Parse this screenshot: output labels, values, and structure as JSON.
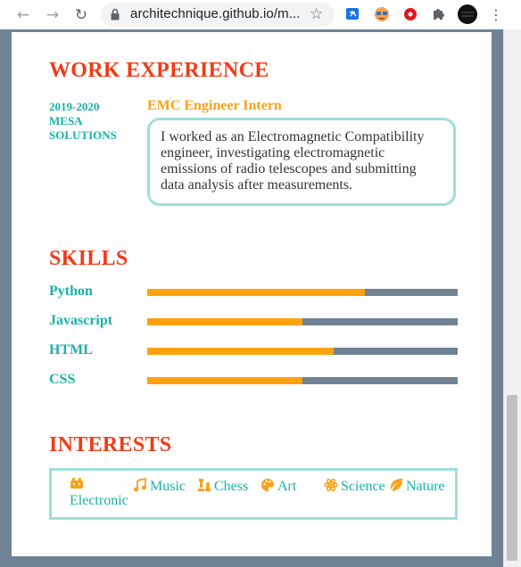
{
  "browser": {
    "url": "architechnique.github.io/m..."
  },
  "work": {
    "heading": "WORK EXPERIENCE",
    "jobs": [
      {
        "period": "2019-2020",
        "company": "MESA SOLUTIONS",
        "title": "EMC Engineer Intern",
        "description": "I worked as an Electromagnetic Compatibility engineer, investigating electromagnetic emissions of radio telescopes and submitting data analysis after measurements."
      }
    ]
  },
  "skills": {
    "heading": "SKILLS",
    "items": [
      {
        "name": "Python",
        "level": 0.7
      },
      {
        "name": "Javascript",
        "level": 0.5
      },
      {
        "name": "HTML",
        "level": 0.6
      },
      {
        "name": "CSS",
        "level": 0.5
      }
    ]
  },
  "interests": {
    "heading": "INTERESTS",
    "items": [
      {
        "label": "Electronic",
        "icon": "electronics-icon"
      },
      {
        "label": "Music",
        "icon": "music-icon"
      },
      {
        "label": "Chess",
        "icon": "chess-icon"
      },
      {
        "label": "Art",
        "icon": "palette-icon"
      },
      {
        "label": "Science",
        "icon": "atom-icon"
      },
      {
        "label": "Nature",
        "icon": "leaf-icon"
      }
    ]
  },
  "colors": {
    "heading": "#f23a16",
    "accent_teal": "#19b1a8",
    "accent_orange": "#f7a21b",
    "bar_track": "#6f8395",
    "bar_fill": "#ffa10a",
    "border_teal": "#9fdfdb"
  }
}
